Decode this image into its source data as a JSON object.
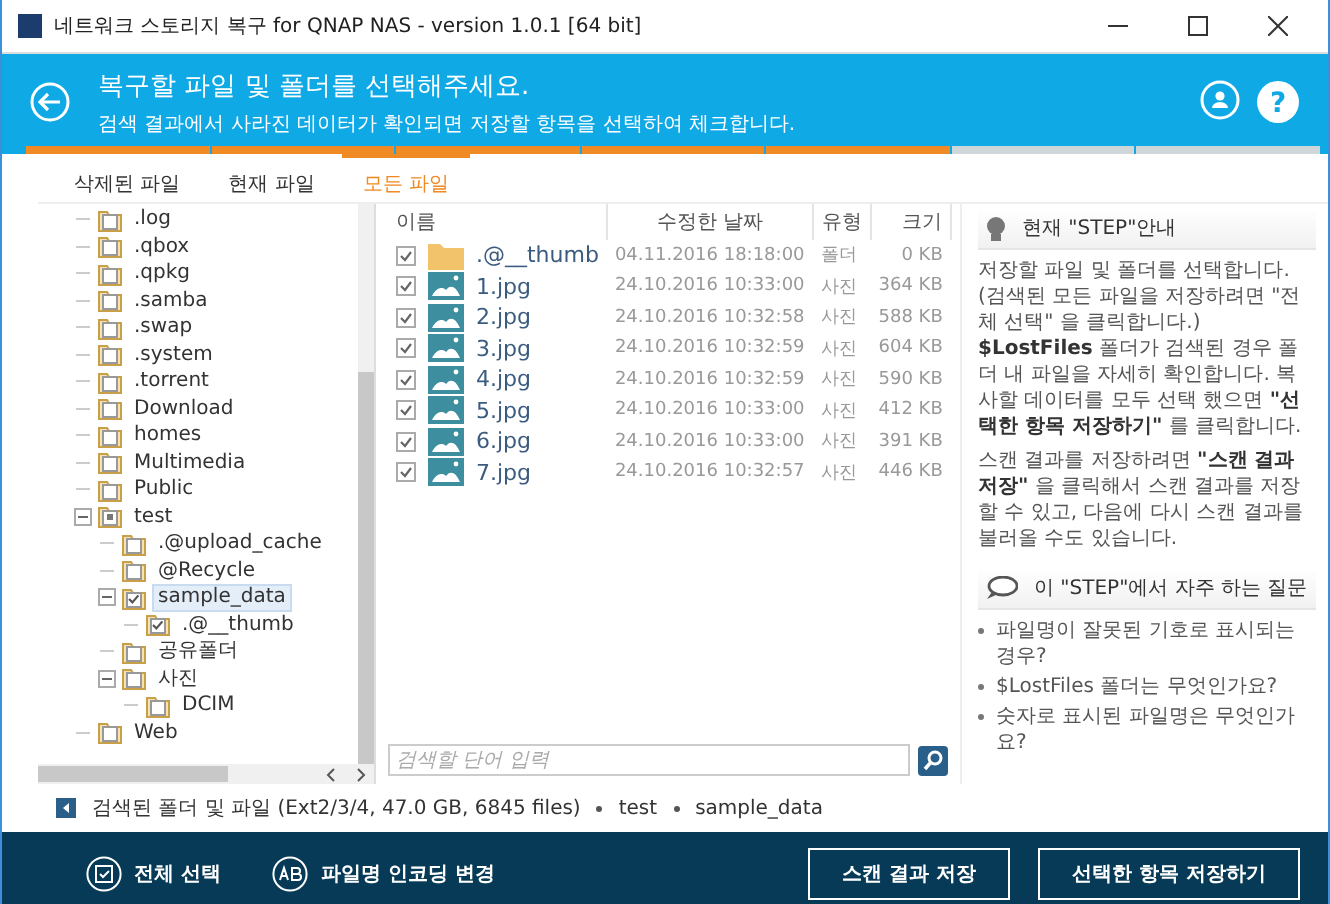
{
  "window": {
    "title": "네트워크 스토리지 복구 for QNAP NAS - version 1.0.1 [64 bit]"
  },
  "header": {
    "title": "복구할 파일 및 폴더를 선택해주세요.",
    "subtitle": "검색 결과에서 사라진 데이터가 확인되면 저장할 항목을 선택하여 체크합니다.",
    "help_label": "?",
    "steps": [
      {
        "done": true
      },
      {
        "done": true
      },
      {
        "done": true
      },
      {
        "done": true
      },
      {
        "done": true
      },
      {
        "done": false
      },
      {
        "done": false
      }
    ]
  },
  "tabs": [
    {
      "label": "삭제된 파일",
      "selected": false
    },
    {
      "label": "현재 파일",
      "selected": false
    },
    {
      "label": "모든 파일",
      "selected": true
    }
  ],
  "tree": [
    {
      "label": ".log",
      "checked": false,
      "partial": false,
      "selected": false
    },
    {
      "label": ".qbox",
      "checked": false,
      "partial": false,
      "selected": false
    },
    {
      "label": ".qpkg",
      "checked": false,
      "partial": false,
      "selected": false
    },
    {
      "label": ".samba",
      "checked": false,
      "partial": false,
      "selected": false
    },
    {
      "label": ".swap",
      "checked": false,
      "partial": false,
      "selected": false
    },
    {
      "label": ".system",
      "checked": false,
      "partial": false,
      "selected": false
    },
    {
      "label": ".torrent",
      "checked": false,
      "partial": false,
      "selected": false
    },
    {
      "label": "Download",
      "checked": false,
      "partial": false,
      "selected": false
    },
    {
      "label": "homes",
      "checked": false,
      "partial": false,
      "selected": false
    },
    {
      "label": "Multimedia",
      "checked": false,
      "partial": false,
      "selected": false
    },
    {
      "label": "Public",
      "checked": false,
      "partial": false,
      "selected": false
    },
    {
      "label": "test",
      "checked": false,
      "partial": true,
      "selected": false,
      "expanded": true,
      "children": [
        {
          "label": ".@upload_cache",
          "checked": false,
          "partial": false,
          "selected": false
        },
        {
          "label": "@Recycle",
          "checked": false,
          "partial": false,
          "selected": false
        },
        {
          "label": "sample_data",
          "checked": true,
          "partial": false,
          "selected": true,
          "expanded": true,
          "children": [
            {
              "label": ".@__thumb",
              "checked": true,
              "partial": false,
              "selected": false
            }
          ]
        },
        {
          "label": "공유폴더",
          "checked": false,
          "partial": false,
          "selected": false
        },
        {
          "label": "사진",
          "checked": false,
          "partial": false,
          "selected": false,
          "expanded": true,
          "children": [
            {
              "label": "DCIM",
              "checked": false,
              "partial": false,
              "selected": false
            }
          ]
        }
      ]
    },
    {
      "label": "Web",
      "checked": false,
      "partial": false,
      "selected": false
    }
  ],
  "files": {
    "columns": [
      "이름",
      "수정한 날짜",
      "유형",
      "크기"
    ],
    "rows": [
      {
        "checked": true,
        "kind": "folder",
        "name": ".@__thumb",
        "date": "04.11.2016 18:18:00",
        "type": "폴더",
        "size": "0 KB"
      },
      {
        "checked": true,
        "kind": "image",
        "name": "1.jpg",
        "date": "24.10.2016 10:33:00",
        "type": "사진",
        "size": "364 KB"
      },
      {
        "checked": true,
        "kind": "image",
        "name": "2.jpg",
        "date": "24.10.2016 10:32:58",
        "type": "사진",
        "size": "588 KB"
      },
      {
        "checked": true,
        "kind": "image",
        "name": "3.jpg",
        "date": "24.10.2016 10:32:59",
        "type": "사진",
        "size": "604 KB"
      },
      {
        "checked": true,
        "kind": "image",
        "name": "4.jpg",
        "date": "24.10.2016 10:32:59",
        "type": "사진",
        "size": "590 KB"
      },
      {
        "checked": true,
        "kind": "image",
        "name": "5.jpg",
        "date": "24.10.2016 10:33:00",
        "type": "사진",
        "size": "412 KB"
      },
      {
        "checked": true,
        "kind": "image",
        "name": "6.jpg",
        "date": "24.10.2016 10:33:00",
        "type": "사진",
        "size": "391 KB"
      },
      {
        "checked": true,
        "kind": "image",
        "name": "7.jpg",
        "date": "24.10.2016 10:32:57",
        "type": "사진",
        "size": "446 KB"
      }
    ],
    "search": {
      "placeholder": "검색할 단어 입력"
    }
  },
  "help": {
    "title": "현재 \"STEP\"안내",
    "paragraphs": [
      "저장할 파일 및 폴더를 선택합니다. (검색된 모든 파일을 저장하려면 \"전체 선택\" 을 클릭합니다.) **$LostFiles** 폴더가 검색된 경우 폴더 내 파일을 자세히 확인합니다. 복사할 데이터를 모두 선택 했으면 **\"선택한 항목 저장하기\"** 를 클릭합니다.",
      "스캔 결과를 저장하려면 **\"스캔 결과 저장\"** 을 클릭해서 스캔 결과를 저장할 수 있고, 다음에 다시 스캔 결과를 불러올 수도 있습니다."
    ],
    "faq_title": "이 \"STEP\"에서 자주 하는 질문",
    "faq": [
      "파일명이 잘못된 기호로 표시되는 경우?",
      "$LostFiles 폴더는 무엇인가요?",
      "숫자로 표시된 파일명은 무엇인가요?"
    ]
  },
  "status": {
    "summary": "검색된 폴더 및 파일 (Ext2/3/4, 47.0 GB, 6845 files)",
    "path": [
      "test",
      "sample_data"
    ]
  },
  "footer": {
    "left": [
      {
        "kind": "select_all",
        "label": "전체 선택"
      },
      {
        "kind": "encoding",
        "label": "파일명 인코딩 변경"
      }
    ],
    "right": [
      "스캔 결과 저장",
      "선택한 항목 저장하기"
    ]
  }
}
